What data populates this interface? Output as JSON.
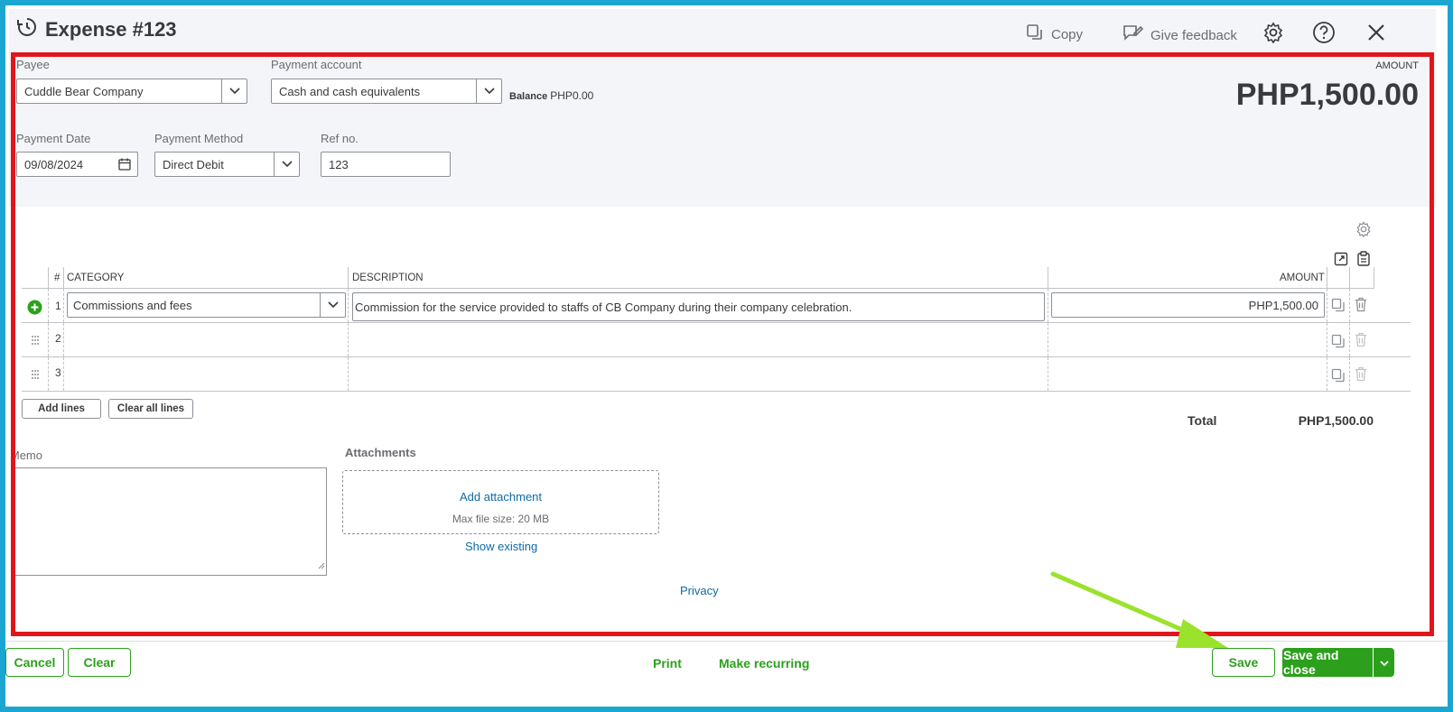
{
  "header": {
    "title": "Expense #123",
    "copy_label": "Copy",
    "feedback_label": "Give feedback"
  },
  "form": {
    "payee_label": "Payee",
    "payee_value": "Cuddle Bear Company",
    "account_label": "Payment account",
    "account_value": "Cash and cash equivalents",
    "balance_label": "Balance",
    "balance_value": "PHP0.00",
    "amount_caption": "AMOUNT",
    "amount_value": "PHP1,500.00",
    "date_label": "Payment Date",
    "date_value": "09/08/2024",
    "method_label": "Payment Method",
    "method_value": "Direct Debit",
    "ref_label": "Ref no.",
    "ref_value": "123"
  },
  "table": {
    "headers": {
      "num": "#",
      "category": "CATEGORY",
      "description": "DESCRIPTION",
      "amount": "AMOUNT"
    },
    "rows": [
      {
        "num": "1",
        "category": "Commissions and fees",
        "description": "Commission for the service provided to staffs of CB Company during their company celebration.",
        "amount": "PHP1,500.00"
      },
      {
        "num": "2",
        "category": "",
        "description": "",
        "amount": ""
      },
      {
        "num": "3",
        "category": "",
        "description": "",
        "amount": ""
      }
    ],
    "add_lines": "Add lines",
    "clear_all_lines": "Clear all lines",
    "total_label": "Total",
    "total_value": "PHP1,500.00"
  },
  "memo": {
    "label": "Memo",
    "value": ""
  },
  "attachments": {
    "label": "Attachments",
    "add_label": "Add attachment",
    "max_size": "Max file size: 20 MB",
    "show_existing": "Show existing"
  },
  "privacy": "Privacy",
  "footer": {
    "cancel": "Cancel",
    "clear": "Clear",
    "print": "Print",
    "make_recurring": "Make recurring",
    "save": "Save",
    "save_and_close": "Save and close"
  },
  "colors": {
    "accent_green": "#2ca01c",
    "link_blue": "#0d6aa8",
    "highlight_red": "#e2151c",
    "frame_blue": "#1aa6d0",
    "arrow_green": "#9be22d"
  }
}
